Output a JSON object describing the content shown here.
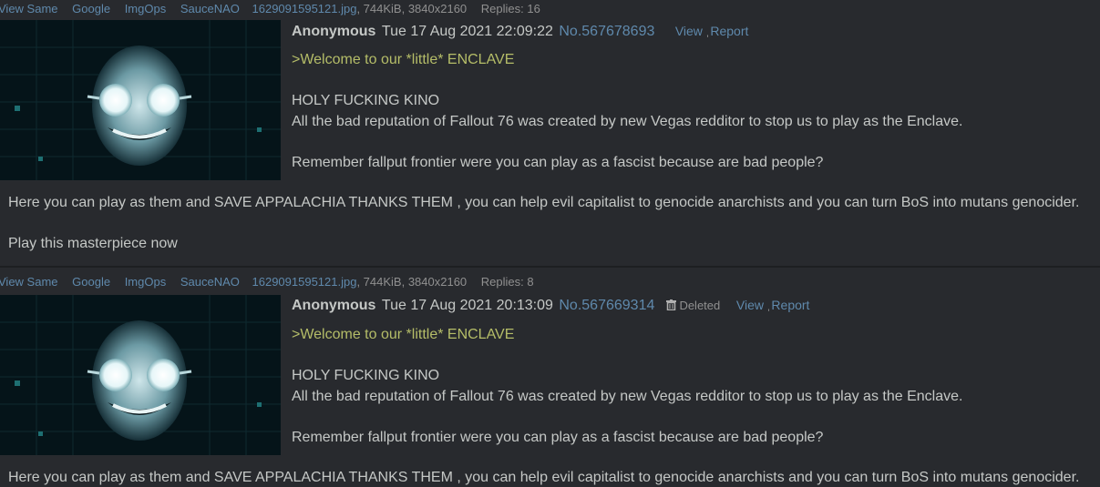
{
  "posts": [
    {
      "file_links": [
        "View Same",
        "Google",
        "ImgOps",
        "SauceNAO"
      ],
      "filename": "1629091595121.jpg",
      "file_meta": ", 744KiB, 3840x2160",
      "replies": "Replies: 16",
      "name": "Anonymous",
      "date": "Tue 17 Aug 2021 22:09:22",
      "post_no": "No.567678693",
      "deleted": "",
      "view_label": "View",
      "report_label": "Report",
      "greentext": ">Welcome to our *little* ENCLAVE",
      "lines": [
        "HOLY FUCKING KINO",
        "All the bad reputation of Fallout 76 was created by new Vegas redditor to stop us to play as the Enclave.",
        "Remember fallput frontier were you can play as a fascist because are bad people?",
        "Here you can play as them and SAVE APPALACHIA THANKS THEM , you can help evil capitalist to genocide anarchists and you can turn BoS into mutans genocider.",
        "Play this masterpiece now"
      ]
    },
    {
      "file_links": [
        "View Same",
        "Google",
        "ImgOps",
        "SauceNAO"
      ],
      "filename": "1629091595121.jpg",
      "file_meta": ", 744KiB, 3840x2160",
      "replies": "Replies: 8",
      "name": "Anonymous",
      "date": "Tue 17 Aug 2021 20:13:09",
      "post_no": "No.567669314",
      "deleted": "Deleted",
      "view_label": "View",
      "report_label": "Report",
      "greentext": ">Welcome to our *little* ENCLAVE",
      "lines": [
        "HOLY FUCKING KINO",
        "All the bad reputation of Fallout 76 was created by new Vegas redditor to stop us to play as the Enclave.",
        "Remember fallput frontier were you can play as a fascist because are bad people?",
        "Here you can play as them and SAVE APPALACHIA THANKS THEM , you can help evil capitalist to genocide anarchists and you can turn BoS into mutans genocider."
      ]
    }
  ],
  "colors": {
    "background": "#282a2e",
    "text": "#c5c8c6",
    "link": "#5f89ac",
    "greentext": "#b5bd68",
    "muted": "#909090"
  },
  "icons": {
    "thumbnail": "masked-face-thumbnail",
    "deleted": "trash-icon"
  }
}
